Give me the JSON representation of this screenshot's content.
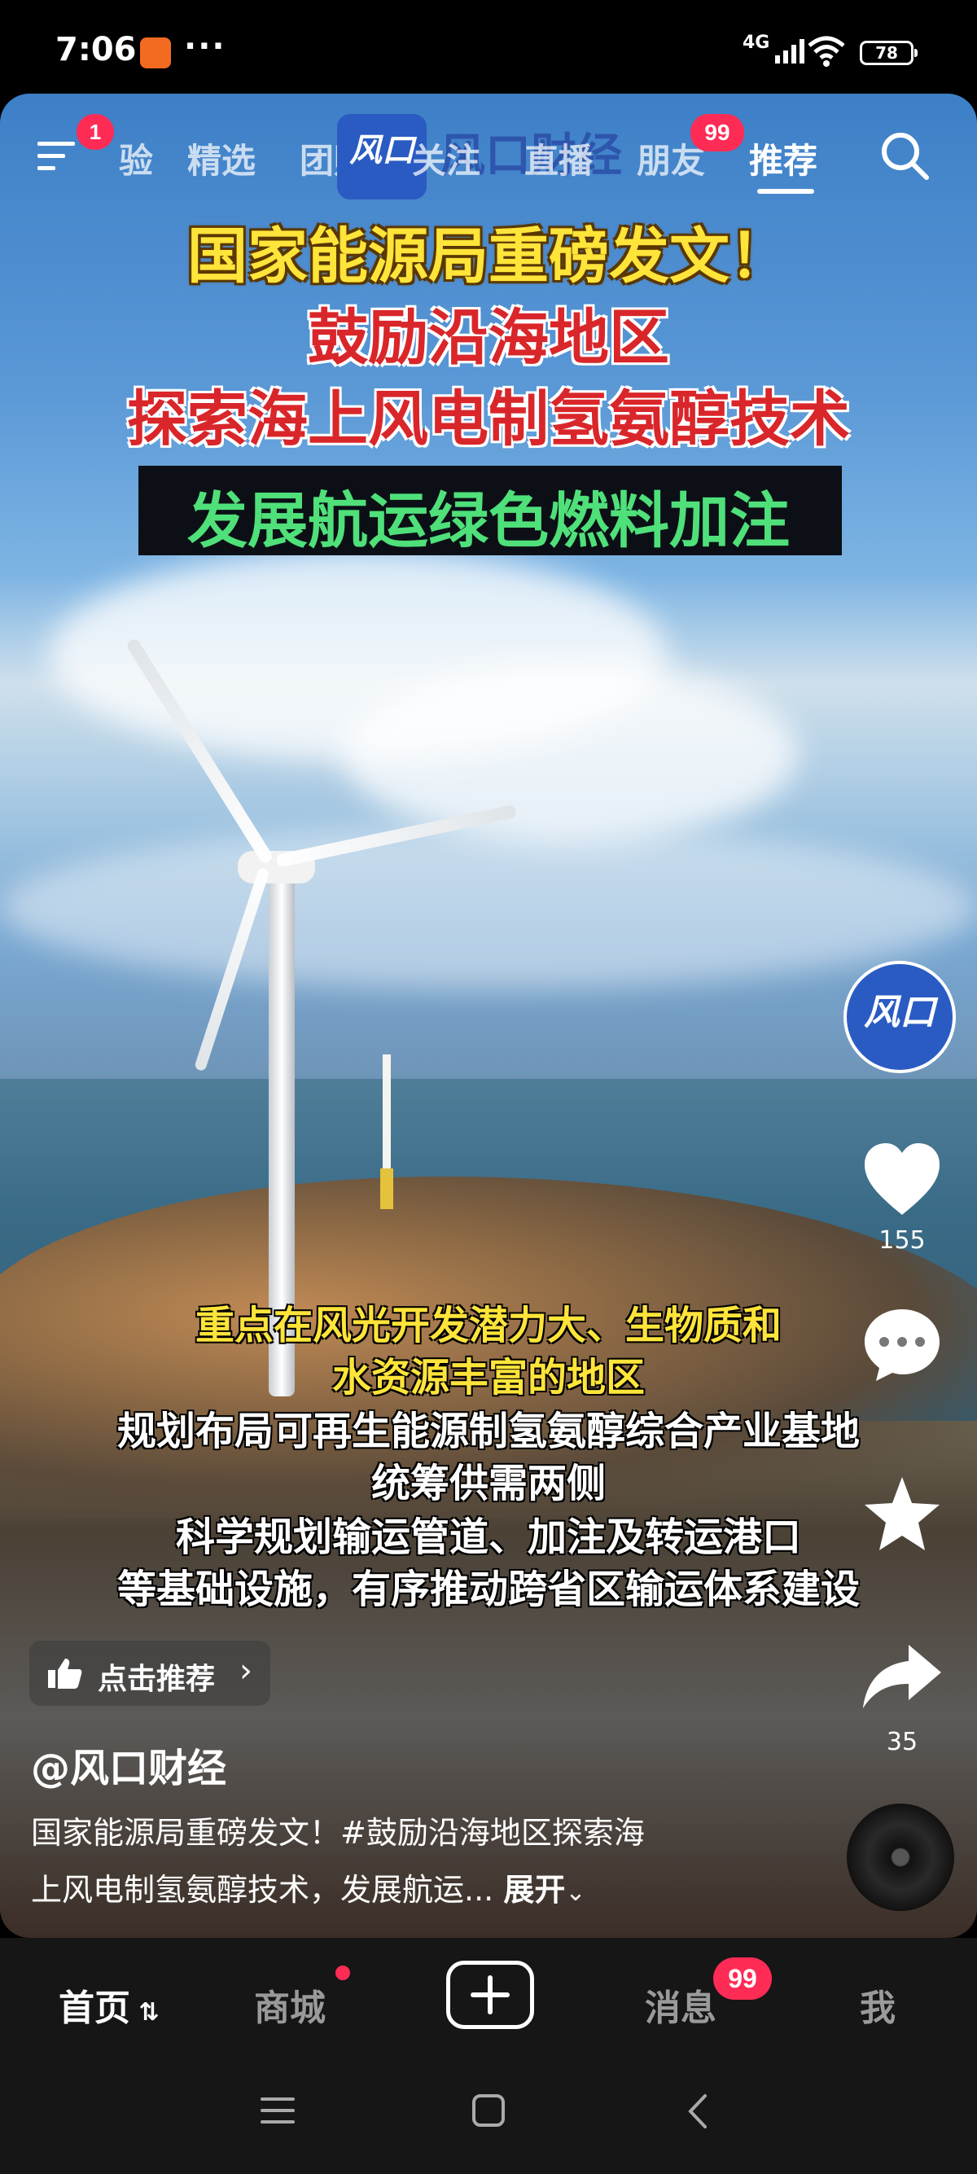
{
  "status_bar": {
    "time": "7:06",
    "dots": "···",
    "network": "4G",
    "battery": "78"
  },
  "top_nav": {
    "notification_badge": "1",
    "tabs": [
      "验",
      "精选",
      "团购",
      "关注",
      "直播",
      "朋友",
      "推荐"
    ],
    "friends_badge": "99",
    "active_tab": "推荐",
    "watermark_logo": "风口",
    "watermark_text": "风口财经"
  },
  "video": {
    "headline": [
      "国家能源局重磅发文！",
      "鼓励沿海地区",
      "探索海上风电制氢氨醇技术",
      "发展航运绿色燃料加注"
    ],
    "subtitles": [
      "重点在风光开发潜力大、生物质和",
      "水资源丰富的地区",
      "规划布局可再生能源制氢氨醇综合产业基地",
      "统筹供需两侧",
      "科学规划输运管道、加注及转运港口",
      "等基础设施，有序推动跨省区输运体系建设"
    ]
  },
  "sidebar": {
    "avatar_label": "风口",
    "like_count": "155",
    "share_count": "35"
  },
  "recommend_label": "点击推荐",
  "author": "@风口财经",
  "description": {
    "line1": "国家能源局重磅发文！#鼓励沿海地区探索海",
    "line2": "上风电制氢氨醇技术，发展航运...",
    "expand": "展开"
  },
  "bottom_nav": {
    "home": "首页",
    "mall": "商城",
    "messages": "消息",
    "messages_badge": "99",
    "me": "我"
  },
  "colors": {
    "accent": "#fe2c55",
    "headline_yellow": "#ffe43a",
    "headline_red": "#d9262a",
    "headline_green": "#4fe07a"
  }
}
